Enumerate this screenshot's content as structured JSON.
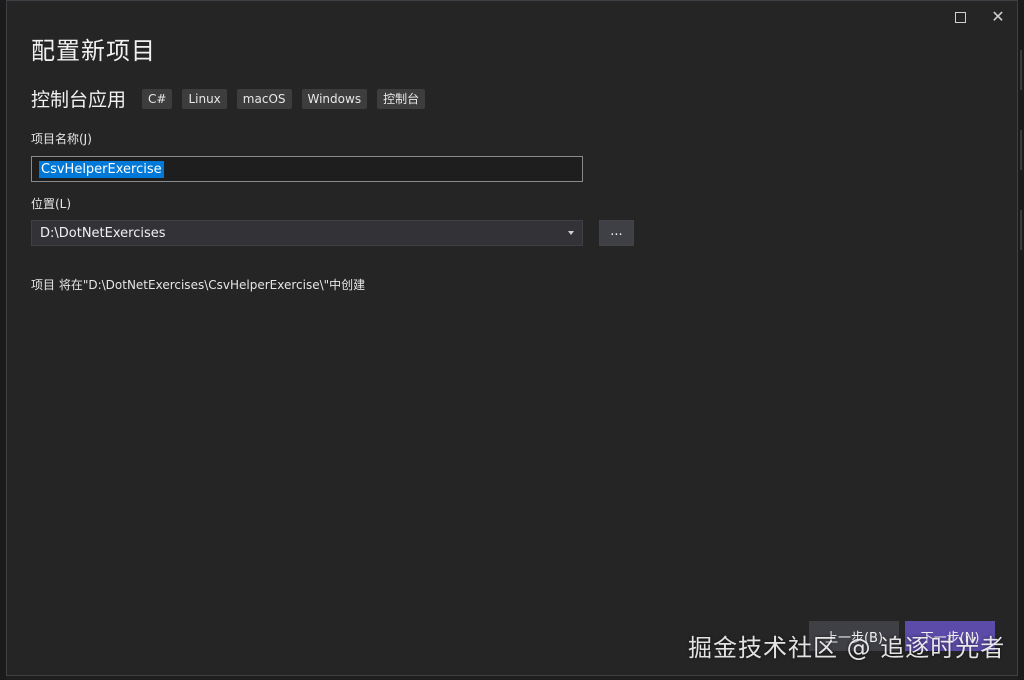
{
  "dialog": {
    "heading": "配置新项目",
    "template_name": "控制台应用",
    "tags": [
      "C#",
      "Linux",
      "macOS",
      "Windows",
      "控制台"
    ]
  },
  "title_bar": {
    "maximize_icon": "maximize-icon",
    "close_icon": "close-icon",
    "close_glyph": "✕"
  },
  "project_name": {
    "label": "项目名称(J)",
    "value": "CsvHelperExercise"
  },
  "location": {
    "label": "位置(L)",
    "value": "D:\\DotNetExercises",
    "browse_label": "..."
  },
  "info_text": "项目 将在\"D:\\DotNetExercises\\CsvHelperExercise\\\"中创建",
  "footer": {
    "back_label": "上一步(B)",
    "next_label": "下一步(N)"
  },
  "watermark": "掘金技术社区 @ 追逐时光者",
  "colors": {
    "background": "#252526",
    "accent": "#0078d7",
    "next_button": "#5c4ba8"
  }
}
